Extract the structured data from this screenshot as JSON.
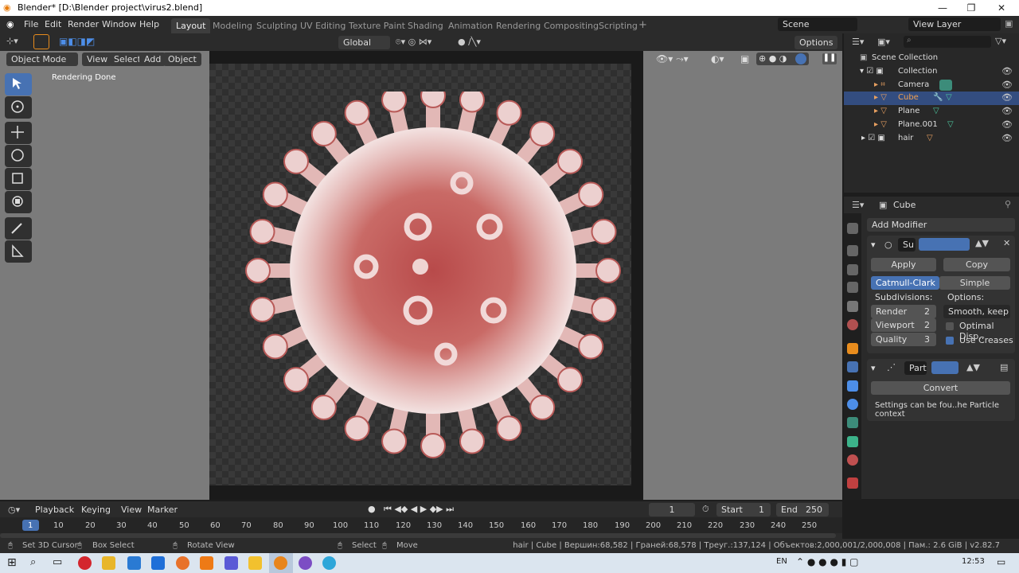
{
  "window": {
    "title": "Blender* [D:\\Blender project\\virus2.blend]"
  },
  "menu": [
    "File",
    "Edit",
    "Render",
    "Window",
    "Help"
  ],
  "workspaces": [
    "Layout",
    "Modeling",
    "Sculpting",
    "UV Editing",
    "Texture Paint",
    "Shading",
    "Animation",
    "Rendering",
    "Compositing",
    "Scripting"
  ],
  "scene": {
    "name": "Scene",
    "view_layer": "View Layer"
  },
  "viewport_header": {
    "mode": "Object Mode",
    "menus": [
      "View",
      "Select",
      "Add",
      "Object"
    ],
    "orientation": "Global",
    "options": "Options"
  },
  "viewport": {
    "overlay_text": "Rendering Done"
  },
  "outliner": {
    "root": "Scene Collection",
    "items": [
      {
        "label": "Collection"
      },
      {
        "label": "Camera"
      },
      {
        "label": "Cube"
      },
      {
        "label": "Plane"
      },
      {
        "label": "Plane.001"
      },
      {
        "label": "hair"
      }
    ]
  },
  "properties": {
    "object": "Cube",
    "add_modifier": "Add Modifier",
    "subsurf": {
      "name": "Su",
      "apply": "Apply",
      "copy": "Copy",
      "catmull": "Catmull-Clark",
      "simple": "Simple",
      "subdivisions": "Subdivisions:",
      "options": "Options:",
      "render_label": "Render",
      "render_value": "2",
      "viewport_label": "Viewport",
      "viewport_value": "2",
      "quality_label": "Quality",
      "quality_value": "3",
      "uv_smooth": "Smooth, keep ...",
      "optimal": "Optimal Disp..",
      "creases": "Use Creases"
    },
    "particle": {
      "name": "Part",
      "convert": "Convert",
      "note": "Settings can be fou..he Particle context"
    }
  },
  "timeline": {
    "menus": [
      "Playback",
      "Keying",
      "View",
      "Marker"
    ],
    "current": "1",
    "start_label": "Start",
    "start": "1",
    "end_label": "End",
    "end": "250",
    "frames": [
      "1",
      "10",
      "20",
      "30",
      "40",
      "50",
      "60",
      "70",
      "80",
      "90",
      "100",
      "110",
      "120",
      "130",
      "140",
      "150",
      "160",
      "170",
      "180",
      "190",
      "200",
      "210",
      "220",
      "230",
      "240",
      "250"
    ]
  },
  "statusbar": {
    "cursor": "Set 3D Cursor",
    "box": "Box Select",
    "rotate": "Rotate View",
    "select": "Select",
    "move": "Move",
    "stats": "hair | Cube | Вершин:68,582 | Граней:68,578 | Треуг.:137,124 | Объектов:2,000,001/2,000,008 | Пам.: 2.6 GiB | v2.82.7"
  },
  "taskbar": {
    "lang": "EN",
    "time": "12:53"
  }
}
